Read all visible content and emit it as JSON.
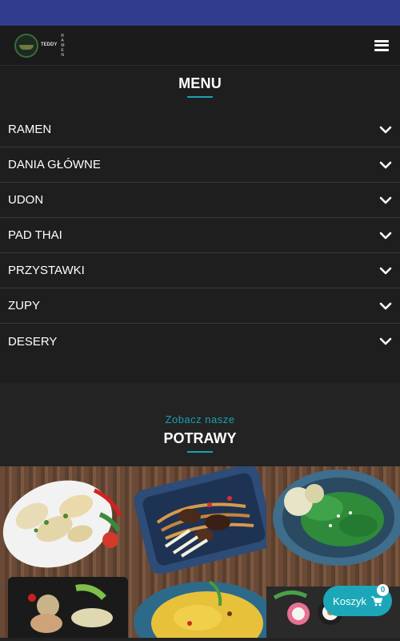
{
  "header": {
    "logo_top": "TEDDY",
    "logo_side": [
      "R",
      "A",
      "M",
      "E",
      "N"
    ]
  },
  "menu": {
    "title": "MENU",
    "items": [
      {
        "label": "RAMEN"
      },
      {
        "label": "DANIA GŁÓWNE"
      },
      {
        "label": "UDON"
      },
      {
        "label": "PAD THAI"
      },
      {
        "label": "PRZYSTAWKI"
      },
      {
        "label": "ZUPY"
      },
      {
        "label": "DESERY"
      }
    ]
  },
  "dishes": {
    "subtitle": "Zobacz nasze",
    "title": "POTRAWY"
  },
  "cart": {
    "label": "Koszyk",
    "count": "0"
  },
  "colors": {
    "accent": "#1aa0b4",
    "status_bar": "#323c8f",
    "background": "#232323"
  },
  "icons": {
    "menu": "hamburger-icon",
    "expand": "chevron-down-icon",
    "cart": "shopping-cart-icon"
  }
}
